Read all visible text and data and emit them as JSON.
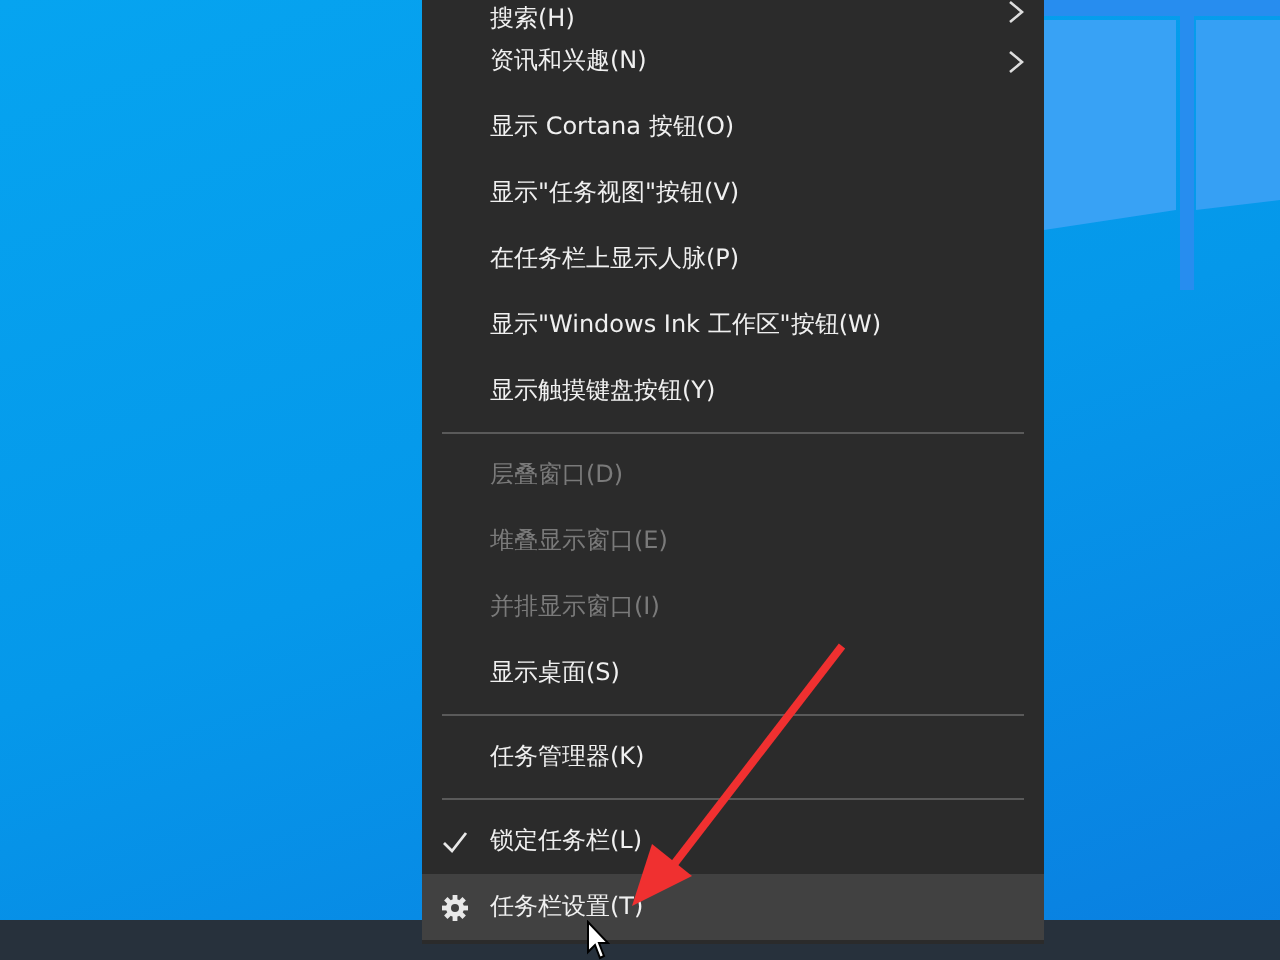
{
  "context_menu": {
    "items": [
      {
        "kind": "item",
        "label": "搜索(H)",
        "disabled": false,
        "submenu": true,
        "checked": false,
        "selected": false
      },
      {
        "kind": "item",
        "label": "资讯和兴趣(N)",
        "disabled": false,
        "submenu": true,
        "checked": false,
        "selected": false
      },
      {
        "kind": "item",
        "label": "显示 Cortana 按钮(O)",
        "disabled": false,
        "submenu": false,
        "checked": false,
        "selected": false
      },
      {
        "kind": "item",
        "label": "显示\"任务视图\"按钮(V)",
        "disabled": false,
        "submenu": false,
        "checked": false,
        "selected": false
      },
      {
        "kind": "item",
        "label": "在任务栏上显示人脉(P)",
        "disabled": false,
        "submenu": false,
        "checked": false,
        "selected": false
      },
      {
        "kind": "item",
        "label": "显示\"Windows Ink 工作区\"按钮(W)",
        "disabled": false,
        "submenu": false,
        "checked": false,
        "selected": false
      },
      {
        "kind": "item",
        "label": "显示触摸键盘按钮(Y)",
        "disabled": false,
        "submenu": false,
        "checked": false,
        "selected": false
      },
      {
        "kind": "separator"
      },
      {
        "kind": "item",
        "label": "层叠窗口(D)",
        "disabled": true,
        "submenu": false,
        "checked": false,
        "selected": false
      },
      {
        "kind": "item",
        "label": "堆叠显示窗口(E)",
        "disabled": true,
        "submenu": false,
        "checked": false,
        "selected": false
      },
      {
        "kind": "item",
        "label": "并排显示窗口(I)",
        "disabled": true,
        "submenu": false,
        "checked": false,
        "selected": false
      },
      {
        "kind": "item",
        "label": "显示桌面(S)",
        "disabled": false,
        "submenu": false,
        "checked": false,
        "selected": false
      },
      {
        "kind": "separator"
      },
      {
        "kind": "item",
        "label": "任务管理器(K)",
        "disabled": false,
        "submenu": false,
        "checked": false,
        "selected": false
      },
      {
        "kind": "separator"
      },
      {
        "kind": "item",
        "label": "锁定任务栏(L)",
        "disabled": false,
        "submenu": false,
        "checked": true,
        "selected": false
      },
      {
        "kind": "settings_item",
        "label": "任务栏设置(T)",
        "disabled": false,
        "submenu": false,
        "checked": false,
        "selected": true
      }
    ]
  }
}
